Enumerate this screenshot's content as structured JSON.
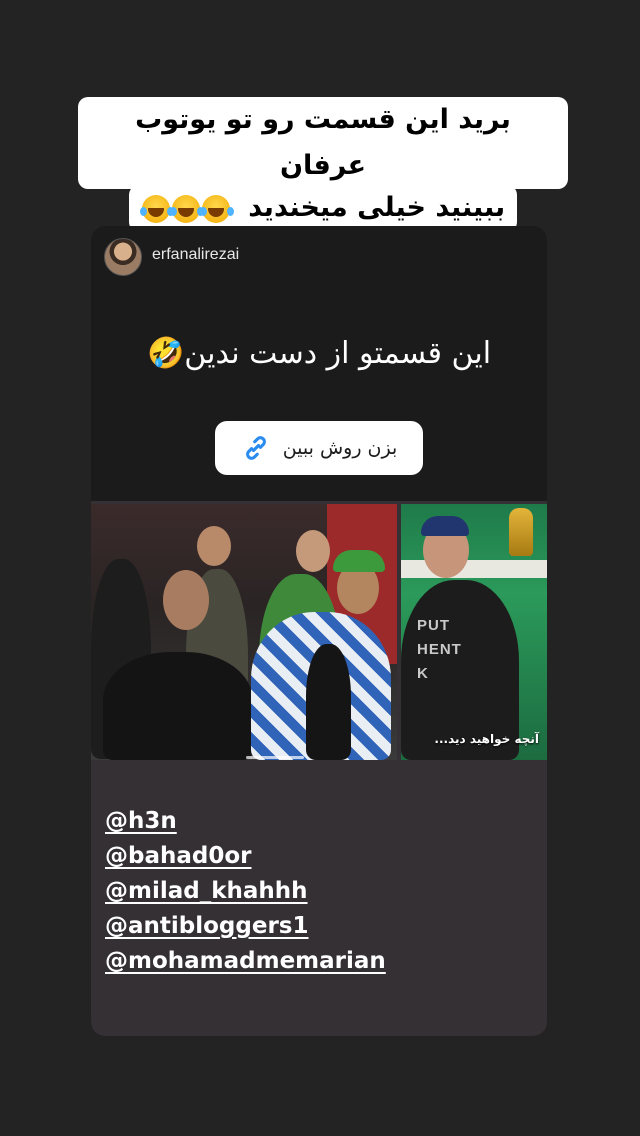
{
  "caption": {
    "line1": "برید این قسمت رو تو یوتوب عرفان",
    "line2": "ببینید خیلی میخندید",
    "emoji": "face-with-tears-of-joy-icon x3"
  },
  "post": {
    "username": "erfanalirezai",
    "headline": "این قسمتو از دست ندین🤣",
    "link_label": "بزن روش ببین",
    "video_overlay_text": "آنچه خواهید دید...",
    "shirt_text": [
      "PUT",
      "HENT",
      "K"
    ]
  },
  "mentions": [
    "@h3n",
    "@bahad0or",
    "@milad_khahhh",
    "@antibloggers1",
    "@mohamadmemarian"
  ],
  "colors": {
    "background": "#232323",
    "card": "#343034",
    "sticker": "#ffffff"
  }
}
